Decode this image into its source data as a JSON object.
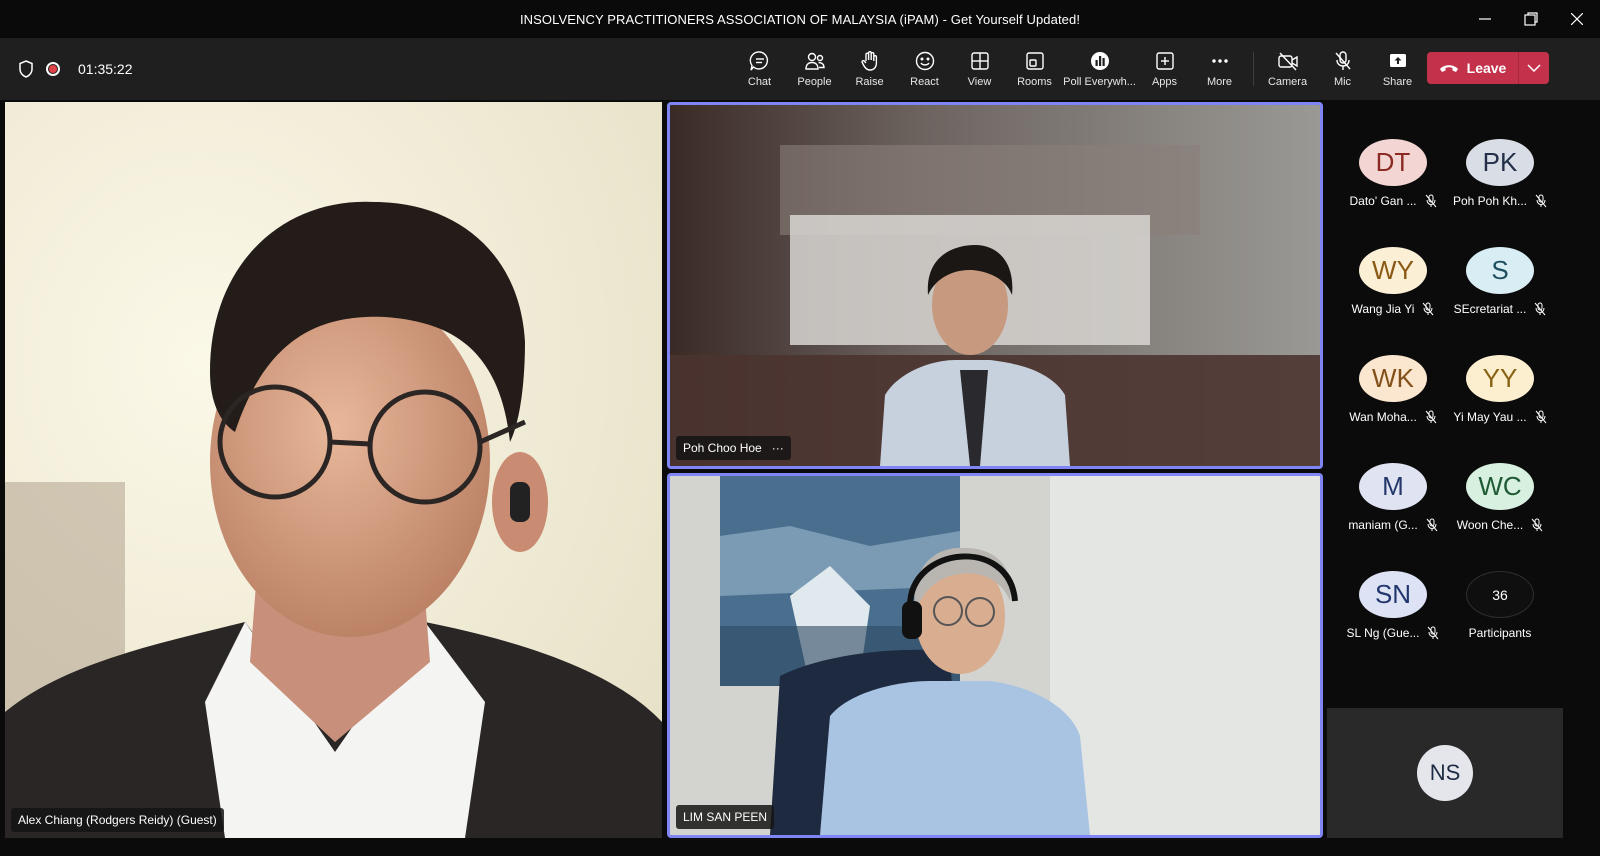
{
  "window": {
    "title": "INSOLVENCY PRACTITIONERS ASSOCIATION OF MALAYSIA (iPAM) - Get Yourself Updated!"
  },
  "toolbar": {
    "timer": "01:35:22",
    "items": [
      {
        "label": "Chat",
        "icon": "chat-icon"
      },
      {
        "label": "People",
        "icon": "people-icon"
      },
      {
        "label": "Raise",
        "icon": "raise-hand-icon"
      },
      {
        "label": "React",
        "icon": "react-icon"
      },
      {
        "label": "View",
        "icon": "view-icon"
      },
      {
        "label": "Rooms",
        "icon": "rooms-icon"
      },
      {
        "label": "Poll Everywh...",
        "icon": "poll-icon"
      },
      {
        "label": "Apps",
        "icon": "apps-icon"
      },
      {
        "label": "More",
        "icon": "more-icon"
      }
    ],
    "media": [
      {
        "label": "Camera",
        "icon": "camera-off-icon"
      },
      {
        "label": "Mic",
        "icon": "mic-off-icon"
      },
      {
        "label": "Share",
        "icon": "share-icon"
      }
    ],
    "leave_label": "Leave"
  },
  "tiles": {
    "main": {
      "name": "Alex Chiang (Rodgers Reidy) (Guest)"
    },
    "top": {
      "name": "Poh Choo Hoe",
      "more": "···"
    },
    "bottom": {
      "name": "LIM SAN PEEN"
    }
  },
  "roster": {
    "people": [
      {
        "initials": "DT",
        "name": "Dato' Gan ...",
        "bg": "#f3d6d3",
        "fg": "#8a2a22"
      },
      {
        "initials": "PK",
        "name": "Poh Poh Kh...",
        "bg": "#d9dde6",
        "fg": "#24304a"
      },
      {
        "initials": "WY",
        "name": "Wang Jia Yi",
        "bg": "#fbefd6",
        "fg": "#8a5a14"
      },
      {
        "initials": "S",
        "name": "SEcretariat ...",
        "bg": "#d8eef4",
        "fg": "#1e4f5e"
      },
      {
        "initials": "WK",
        "name": "Wan Moha...",
        "bg": "#fbe6cf",
        "fg": "#84501a"
      },
      {
        "initials": "YY",
        "name": "Yi May Yau ...",
        "bg": "#fcefd0",
        "fg": "#8a6214"
      },
      {
        "initials": "M",
        "name": "maniam (G...",
        "bg": "#dfe3f2",
        "fg": "#26386a"
      },
      {
        "initials": "WC",
        "name": "Woon Che...",
        "bg": "#d7f0df",
        "fg": "#1f5a34"
      },
      {
        "initials": "SN",
        "name": "SL Ng (Gue...",
        "bg": "#dde3f5",
        "fg": "#22366e"
      }
    ],
    "participants_count": "36",
    "participants_label": "Participants"
  },
  "spotlight": {
    "initials": "NS"
  }
}
